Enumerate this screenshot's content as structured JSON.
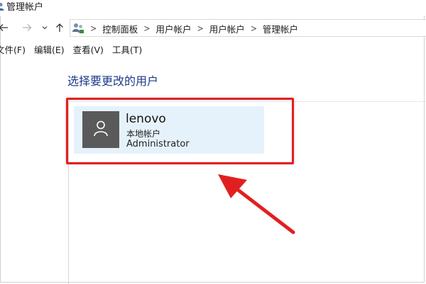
{
  "window": {
    "title": "管理帐户"
  },
  "nav": {
    "breadcrumbs": [
      "控制面板",
      "用户帐户",
      "用户帐户",
      "管理帐户"
    ]
  },
  "menu": {
    "items": [
      "文件(F)",
      "编辑(E)",
      "查看(V)",
      "工具(T)"
    ]
  },
  "main": {
    "title": "选择要更改的用户",
    "account": {
      "name": "lenovo",
      "type": "本地帐户",
      "role": "Administrator"
    }
  },
  "colors": {
    "title_blue": "#1e3a8a",
    "tile_bg": "#e6f2fb",
    "avatar_bg": "#5a5a5a",
    "annotation_red": "#e02020"
  },
  "icons": {
    "title": "users-icon",
    "back": "arrow-left-icon",
    "forward": "arrow-right-icon",
    "recent": "chevron-down-icon",
    "up": "arrow-up-icon",
    "address": "control-panel-users-icon",
    "avatar": "user-silhouette-icon"
  }
}
